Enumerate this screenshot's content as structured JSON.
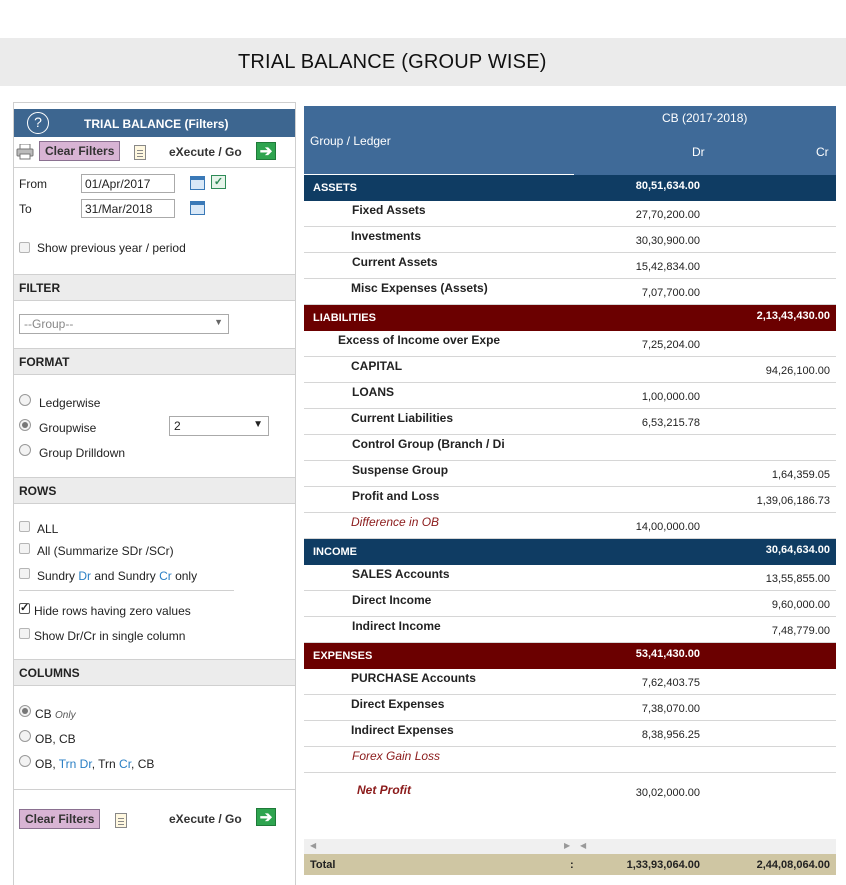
{
  "page_title": "TRIAL BALANCE (GROUP WISE)",
  "filters": {
    "title": "TRIAL BALANCE (Filters)",
    "clear_label": "Clear Filters",
    "execute_label": "eXecute / Go",
    "from_label": "From",
    "from_value": "01/Apr/2017",
    "to_label": "To",
    "to_value": "31/Mar/2018",
    "prev_year_label": "Show previous year / period"
  },
  "filter_section": {
    "heading": "FILTER",
    "group_select": "--Group--"
  },
  "format_section": {
    "heading": "FORMAT",
    "options": [
      "Ledgerwise",
      "Groupwise",
      "Group Drilldown"
    ],
    "selected": "Groupwise",
    "level_value": "2"
  },
  "rows_section": {
    "heading": "ROWS",
    "all_label": "ALL",
    "summarize_label": "All (Summarize SDr /SCr)",
    "sundry_prefix": "Sundry ",
    "sundry_dr": "Dr",
    "sundry_mid": " and Sundry ",
    "sundry_cr": "Cr",
    "sundry_suffix": " only",
    "hide_zero_label": "Hide rows having zero values",
    "single_col_label": "Show Dr/Cr in single column"
  },
  "columns_section": {
    "heading": "COLUMNS",
    "cb_label": "CB",
    "cb_only": "Only",
    "obcb_label": "OB, CB",
    "ob_prefix": "OB, ",
    "trn_dr": "Trn Dr",
    "sep": ", ",
    "trn_cr_a": "Trn ",
    "trn_cr_b": "Cr",
    "cb_suffix": ", CB"
  },
  "table": {
    "col_group": "Group / Ledger",
    "col_period": "CB (2017-2018)",
    "col_dr": "Dr",
    "col_cr": "Cr",
    "rows": [
      {
        "name": "ASSETS",
        "dr": "80,51,634.00",
        "cr": ""
      },
      {
        "name": "Fixed Assets",
        "dr": "27,70,200.00",
        "cr": ""
      },
      {
        "name": "Investments",
        "dr": "30,30,900.00",
        "cr": ""
      },
      {
        "name": "Current Assets",
        "dr": "15,42,834.00",
        "cr": ""
      },
      {
        "name": "Misc Expenses (Assets)",
        "dr": "7,07,700.00",
        "cr": ""
      },
      {
        "name": "LIABILITIES",
        "dr": "",
        "cr": "2,13,43,430.00"
      },
      {
        "name": "Excess of Income over Expe",
        "dr": "7,25,204.00",
        "cr": ""
      },
      {
        "name": "CAPITAL",
        "dr": "",
        "cr": "94,26,100.00"
      },
      {
        "name": "LOANS",
        "dr": "1,00,000.00",
        "cr": ""
      },
      {
        "name": "Current Liabilities",
        "dr": "6,53,215.78",
        "cr": ""
      },
      {
        "name": "Control Group (Branch / Di",
        "dr": "",
        "cr": ""
      },
      {
        "name": "Suspense Group",
        "dr": "",
        "cr": "1,64,359.05"
      },
      {
        "name": "Profit and Loss",
        "dr": "",
        "cr": "1,39,06,186.73"
      },
      {
        "name": "Difference in OB",
        "dr": "14,00,000.00",
        "cr": ""
      },
      {
        "name": "INCOME",
        "dr": "",
        "cr": "30,64,634.00"
      },
      {
        "name": "SALES Accounts",
        "dr": "",
        "cr": "13,55,855.00"
      },
      {
        "name": "Direct Income",
        "dr": "",
        "cr": "9,60,000.00"
      },
      {
        "name": "Indirect Income",
        "dr": "",
        "cr": "7,48,779.00"
      },
      {
        "name": "EXPENSES",
        "dr": "53,41,430.00",
        "cr": ""
      },
      {
        "name": "PURCHASE Accounts",
        "dr": "7,62,403.75",
        "cr": ""
      },
      {
        "name": "Direct Expenses",
        "dr": "7,38,070.00",
        "cr": ""
      },
      {
        "name": "Indirect Expenses",
        "dr": "8,38,956.25",
        "cr": ""
      },
      {
        "name": "Forex Gain Loss",
        "dr": "",
        "cr": ""
      },
      {
        "name": "Net Profit",
        "dr": "30,02,000.00",
        "cr": ""
      }
    ],
    "total_label": "Total",
    "total_colon": ":",
    "total_dr": "1,33,93,064.00",
    "total_cr": "2,44,08,064.00"
  }
}
